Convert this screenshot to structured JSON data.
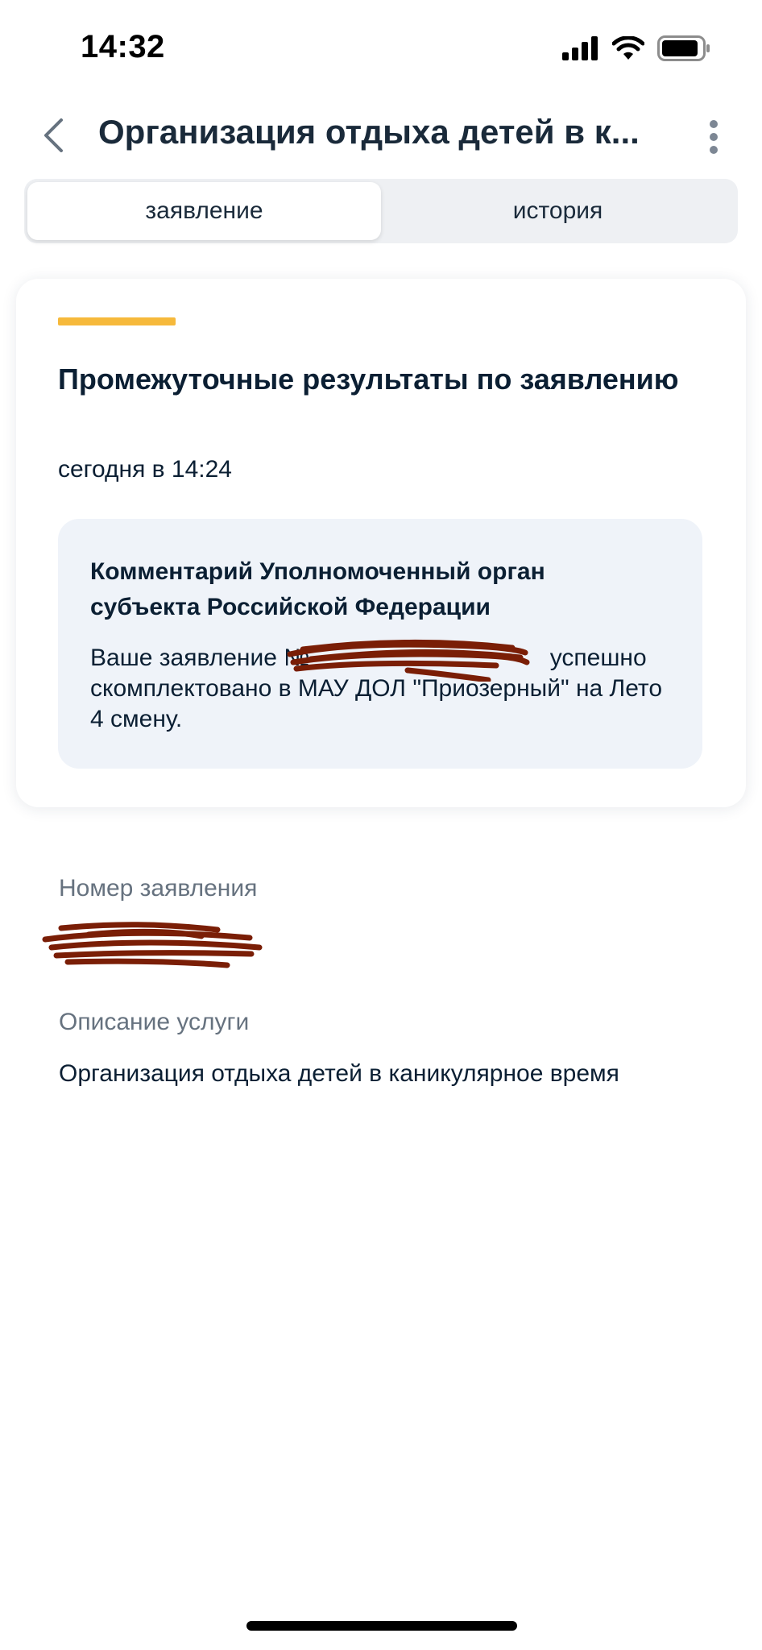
{
  "status_bar": {
    "time": "14:32",
    "icons": [
      "cellular-signal-icon",
      "wifi-icon",
      "battery-icon"
    ]
  },
  "header": {
    "title": "Организация отдыха детей в к...",
    "back_icon": "chevron-left-icon",
    "more_icon": "more-vertical-icon"
  },
  "tabs": [
    {
      "label": "заявление",
      "active": true
    },
    {
      "label": "история",
      "active": false
    }
  ],
  "card": {
    "accent_color": "#f6b93b",
    "title": "Промежуточные результаты по заявлению",
    "date": "сегодня в 14:24",
    "comment": {
      "title": "Комментарий Уполномоченный орган субъекта Российской Федерации",
      "text_before": "Ваше заявление №",
      "text_after": " успешно скомплектовано в МАУ ДОЛ \"Приозерный\" на Лето 4 смену."
    }
  },
  "fields": {
    "number_label": "Номер заявления",
    "description_label": "Описание услуги",
    "description_value": "Организация отдыха детей в каникулярное время"
  },
  "colors": {
    "redaction": "#7a1e06",
    "tab_bg": "#eef0f3",
    "comment_bg": "#eff3f9",
    "label_gray": "#66727f"
  }
}
